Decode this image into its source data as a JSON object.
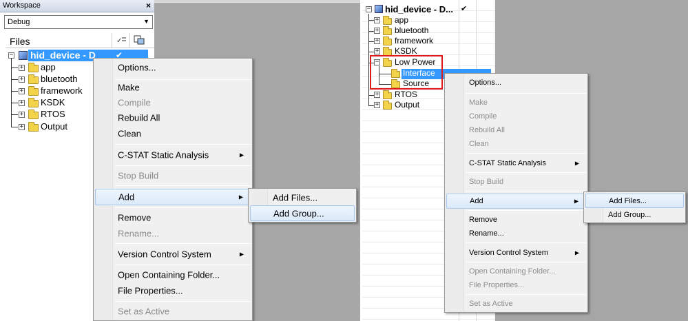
{
  "left": {
    "workspace_title": "Workspace",
    "close_glyph": "×",
    "config_value": "Debug",
    "files_header": "Files",
    "project_name": "hid_device - D",
    "check_glyph": "✔",
    "tree": [
      "app",
      "bluetooth",
      "framework",
      "KSDK",
      "RTOS",
      "Output"
    ],
    "menu": {
      "options": "Options...",
      "make": "Make",
      "compile": "Compile",
      "rebuild_all": "Rebuild All",
      "clean": "Clean",
      "cstat": "C-STAT Static Analysis",
      "stop_build": "Stop Build",
      "add": "Add",
      "remove": "Remove",
      "rename": "Rename...",
      "vcs": "Version Control System",
      "open_folder": "Open Containing Folder...",
      "file_properties": "File Properties...",
      "set_active": "Set as Active"
    },
    "submenu": {
      "add_files": "Add Files...",
      "add_group": "Add Group..."
    }
  },
  "right": {
    "project_name": "hid_device - D...",
    "check_glyph": "✔",
    "tree": [
      "app",
      "bluetooth",
      "framework",
      "KSDK",
      "Low Power",
      "Interface",
      "Source",
      "RTOS",
      "Output"
    ],
    "menu": {
      "options": "Options...",
      "make": "Make",
      "compile": "Compile",
      "rebuild_all": "Rebuild All",
      "clean": "Clean",
      "cstat": "C-STAT Static Analysis",
      "stop_build": "Stop Build",
      "add": "Add",
      "remove": "Remove",
      "rename": "Rename...",
      "vcs": "Version Control System",
      "open_folder": "Open Containing Folder...",
      "file_properties": "File Properties...",
      "set_active": "Set as Active"
    },
    "submenu": {
      "add_files": "Add Files...",
      "add_group": "Add Group..."
    }
  },
  "glyphs": {
    "submenu_arrow": "▶",
    "combo_arrow": "▼",
    "expand": "+",
    "collapse": "−"
  },
  "colors": {
    "highlight": "#3399ff",
    "workspace_bg": "#a6a6a6",
    "annotation": "#e0191c",
    "folder": "#f2d349"
  }
}
